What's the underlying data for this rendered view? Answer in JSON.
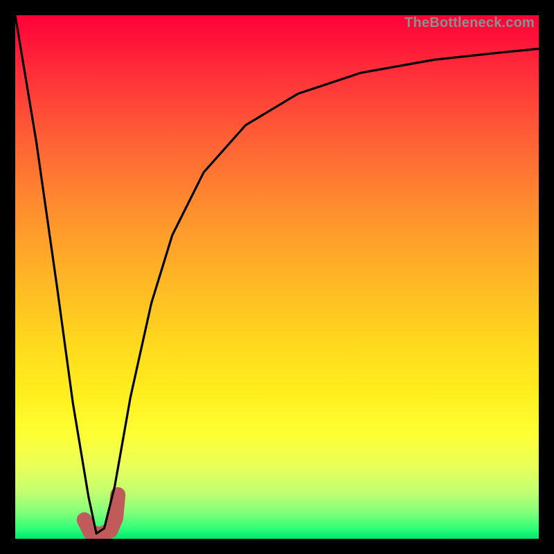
{
  "watermark": "TheBottleneck.com",
  "colors": {
    "frame": "#000000",
    "curve": "#000000",
    "marker": "#c15a5a",
    "gradient_top": "#ff0038",
    "gradient_bottom": "#00e86e"
  },
  "chart_data": {
    "type": "line",
    "title": "",
    "xlabel": "",
    "ylabel": "",
    "xlim": [
      0,
      100
    ],
    "ylim": [
      0,
      100
    ],
    "series": [
      {
        "name": "bottleneck-curve",
        "x": [
          0,
          4,
          8,
          11,
          14,
          15.5,
          17,
          19,
          22,
          26,
          30,
          36,
          44,
          54,
          66,
          80,
          92,
          100
        ],
        "values": [
          100,
          76,
          48,
          26,
          8,
          1,
          2,
          10,
          27,
          45,
          58,
          70,
          79,
          85,
          89,
          91.5,
          92.8,
          93.6
        ]
      }
    ],
    "marker": {
      "name": "J-marker",
      "x": [
        13.2,
        14.4,
        16.2,
        18.2,
        19.2,
        19.6
      ],
      "values": [
        3.6,
        1.2,
        0.8,
        1.6,
        4.0,
        8.4
      ]
    },
    "marker_dot": {
      "x": 13.2,
      "value": 3.6
    }
  }
}
